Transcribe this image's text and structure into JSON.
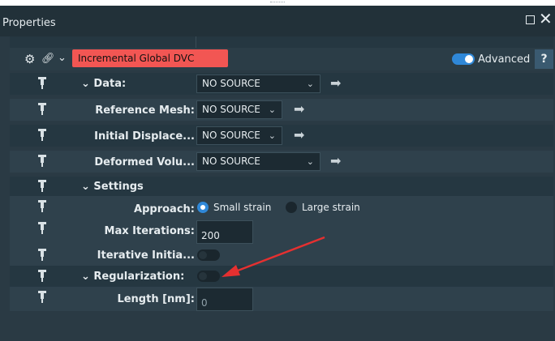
{
  "panel": {
    "title": "Properties"
  },
  "icons": {
    "gear": "gear-icon",
    "link": "link-icon",
    "pin": "pin-icon",
    "arrow": "arrow-right-icon",
    "close": "close-icon",
    "maximize": "maximize-icon"
  },
  "colors": {
    "accent": "#2f88d8",
    "name_field": "#f25653",
    "annotation_arrow": "#e53030"
  },
  "toolbar": {
    "name": "Incremental Global DVC",
    "advanced_label": "Advanced",
    "advanced_on": true,
    "help_label": "?"
  },
  "data_group": {
    "label": "Data:",
    "value": "NO SOURCE",
    "items": [
      {
        "label": "Reference Mesh:",
        "value": "NO SOURCE"
      },
      {
        "label": "Initial Displace...",
        "value": "NO SOURCE"
      },
      {
        "label": "Deformed Volu...",
        "value": "NO SOURCE"
      }
    ]
  },
  "settings_group": {
    "label": "Settings",
    "approach": {
      "label": "Approach:",
      "options": [
        "Small strain",
        "Large strain"
      ],
      "selected": "Small strain"
    },
    "max_iterations": {
      "label": "Max Iterations:",
      "value": "200"
    },
    "iterative_init": {
      "label": "Iterative Initia...",
      "on": false
    }
  },
  "regularization_group": {
    "label": "Regularization:",
    "on": false,
    "length": {
      "label": "Length [nm]:",
      "value": "0"
    }
  }
}
